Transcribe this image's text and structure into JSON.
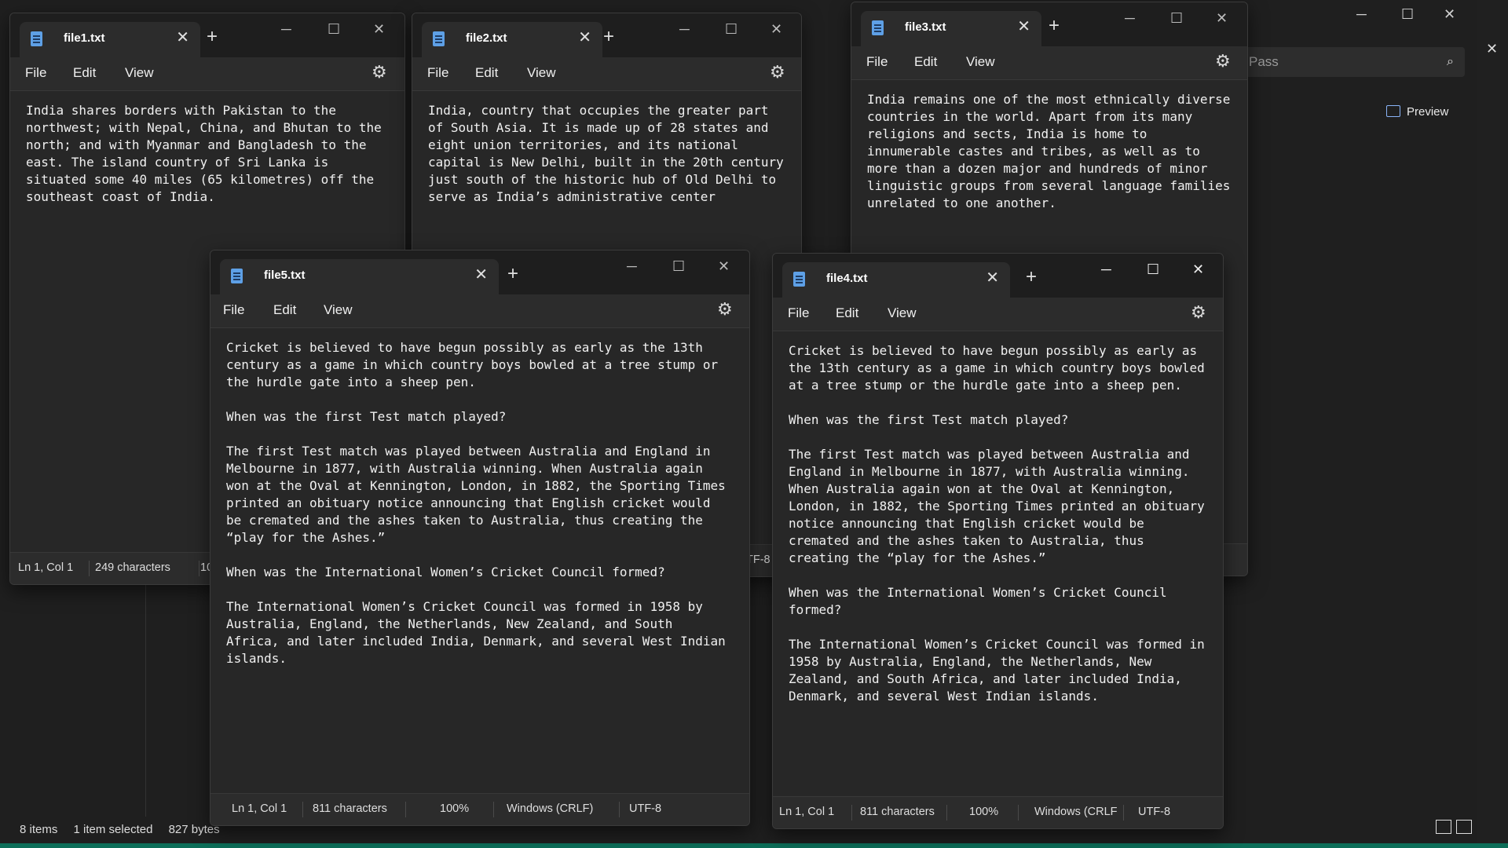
{
  "explorer": {
    "search_placeholder": "Pass",
    "preview_label": "Preview",
    "status_items": "8 items",
    "status_selected": "1 item selected",
    "status_size": "827 bytes"
  },
  "menu": {
    "file": "File",
    "edit": "Edit",
    "view": "View"
  },
  "windows": {
    "file1": {
      "tab_title": "file1.txt",
      "content": "India shares borders with Pakistan to the\nnorthwest; with Nepal, China, and Bhutan to the\nnorth; and with Myanmar and Bangladesh to the\neast. The island country of Sri Lanka is\nsituated some 40 miles (65 kilometres) off the\nsoutheast coast of India.",
      "status_pos": "Ln 1, Col 1",
      "status_chars": "249 characters",
      "status_zoom": "10"
    },
    "file2": {
      "tab_title": "file2.txt",
      "content": "India, country that occupies the greater part\nof South Asia. It is made up of 28 states and\neight union territories, and its national\ncapital is New Delhi, built in the 20th century\njust south of the historic hub of Old Delhi to\nserve as India’s administrative center",
      "status_enc": "TF-8"
    },
    "file3": {
      "tab_title": "file3.txt",
      "content": "India remains one of the most ethnically diverse\ncountries in the world. Apart from its many\nreligions and sects, India is home to\ninnumerable castes and tribes, as well as to\nmore than a dozen major and hundreds of minor\nlinguistic groups from several language families\nunrelated to one another."
    },
    "file4": {
      "tab_title": "file4.txt",
      "content": "Cricket is believed to have begun possibly as early as\nthe 13th century as a game in which country boys bowled\nat a tree stump or the hurdle gate into a sheep pen.\n\nWhen was the first Test match played?\n\nThe first Test match was played between Australia and\nEngland in Melbourne in 1877, with Australia winning.\nWhen Australia again won at the Oval at Kennington,\nLondon, in 1882, the Sporting Times printed an obituary\nnotice announcing that English cricket would be\ncremated and the ashes taken to Australia, thus\ncreating the “play for the Ashes.”\n\nWhen was the International Women’s Cricket Council\nformed?\n\nThe International Women’s Cricket Council was formed in\n1958 by Australia, England, the Netherlands, New\nZealand, and South Africa, and later included India,\nDenmark, and several West Indian islands.",
      "status_pos": "Ln 1, Col 1",
      "status_chars": "811 characters",
      "status_zoom": "100%",
      "status_eol": "Windows (CRLF",
      "status_enc": "UTF-8"
    },
    "file5": {
      "tab_title": "file5.txt",
      "content": "Cricket is believed to have begun possibly as early as the 13th\ncentury as a game in which country boys bowled at a tree stump or\nthe hurdle gate into a sheep pen.\n\nWhen was the first Test match played?\n\nThe first Test match was played between Australia and England in\nMelbourne in 1877, with Australia winning. When Australia again\nwon at the Oval at Kennington, London, in 1882, the Sporting Times\nprinted an obituary notice announcing that English cricket would\nbe cremated and the ashes taken to Australia, thus creating the\n“play for the Ashes.”\n\nWhen was the International Women’s Cricket Council formed?\n\nThe International Women’s Cricket Council was formed in 1958 by\nAustralia, England, the Netherlands, New Zealand, and South\nAfrica, and later included India, Denmark, and several West Indian\nislands.",
      "status_pos": "Ln 1, Col 1",
      "status_chars": "811 characters",
      "status_zoom": "100%",
      "status_eol": "Windows (CRLF)",
      "status_enc": "UTF-8"
    }
  }
}
